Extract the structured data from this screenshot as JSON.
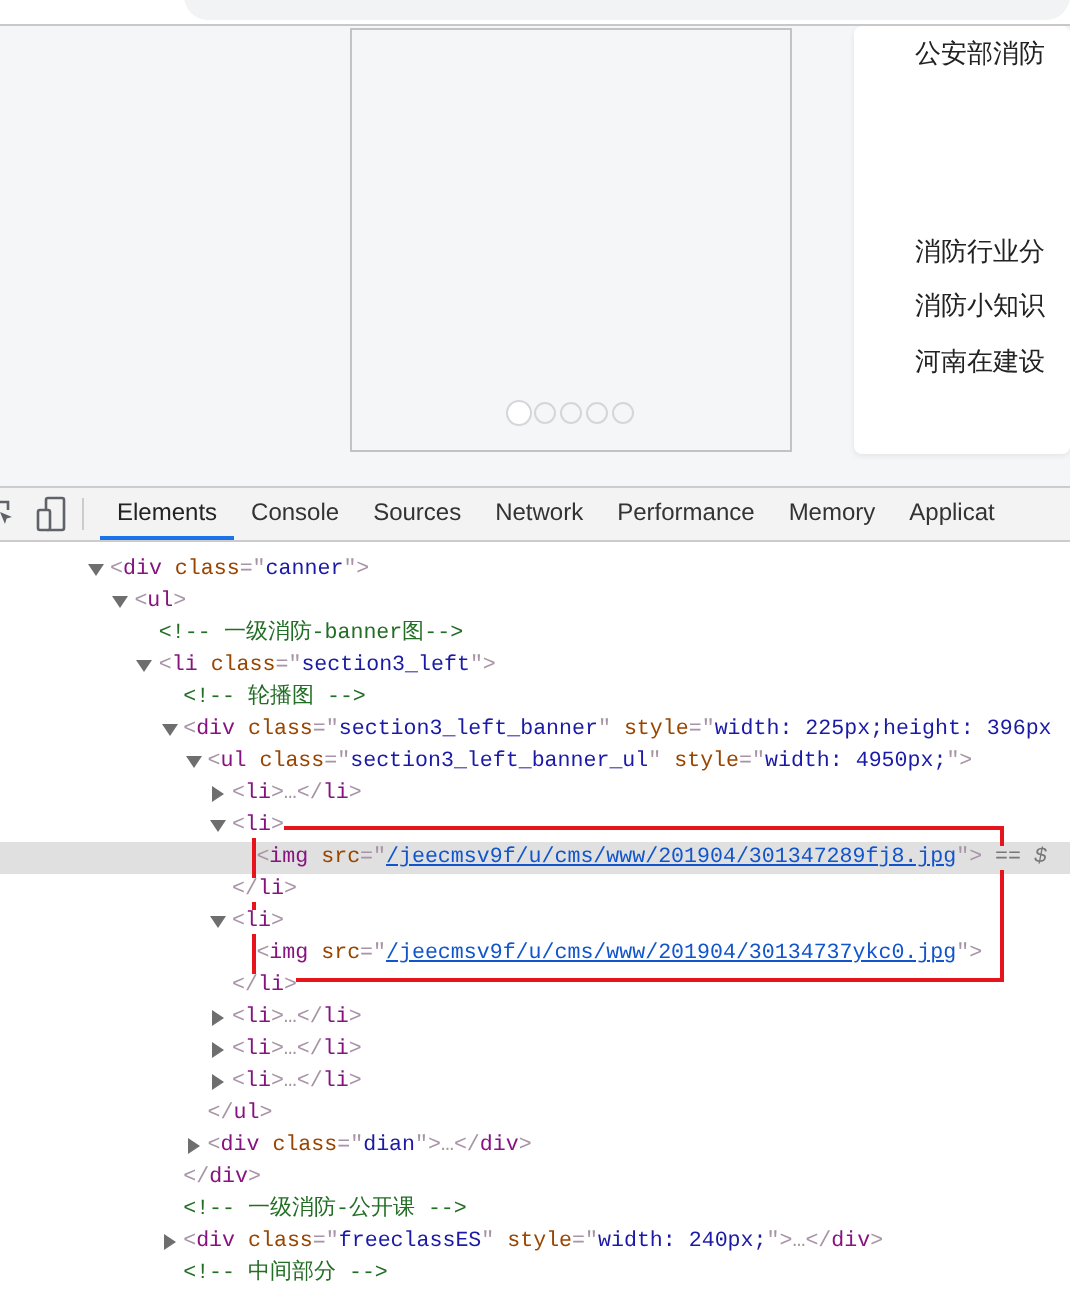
{
  "page": {
    "carousel": {
      "dots": [
        {
          "selected": true
        },
        {
          "selected": false
        },
        {
          "selected": false
        },
        {
          "selected": false
        },
        {
          "selected": false
        }
      ]
    },
    "news": [
      {
        "text": "公安部消防"
      },
      {
        "text": "消防行业分"
      },
      {
        "text": "消防小知识"
      },
      {
        "text": "河南在建设"
      }
    ]
  },
  "devtools": {
    "tabs": [
      {
        "label": "Elements",
        "selected": true
      },
      {
        "label": "Console",
        "selected": false
      },
      {
        "label": "Sources",
        "selected": false
      },
      {
        "label": "Network",
        "selected": false
      },
      {
        "label": "Performance",
        "selected": false
      },
      {
        "label": "Memory",
        "selected": false
      },
      {
        "label": "Applicat",
        "selected": false
      }
    ],
    "tree": [
      {
        "expanded": true,
        "selected": false,
        "tokens": [
          {
            "kind": "punct",
            "text": "<"
          },
          {
            "kind": "tag",
            "text": "div"
          },
          {
            "kind": "attr",
            "text": " class"
          },
          {
            "kind": "punct",
            "text": "=\""
          },
          {
            "kind": "value",
            "text": "canner"
          },
          {
            "kind": "punct",
            "text": "\">"
          }
        ],
        "children": [
          {
            "expanded": true,
            "selected": false,
            "tokens": [
              {
                "kind": "punct",
                "text": "<"
              },
              {
                "kind": "tag",
                "text": "ul"
              },
              {
                "kind": "punct",
                "text": ">"
              }
            ],
            "children": [
              {
                "selected": false,
                "tokens": [
                  {
                    "kind": "comment",
                    "text": "<!-- 一级消防-banner图-->"
                  }
                ]
              },
              {
                "expanded": true,
                "selected": false,
                "tokens": [
                  {
                    "kind": "punct",
                    "text": "<"
                  },
                  {
                    "kind": "tag",
                    "text": "li"
                  },
                  {
                    "kind": "attr",
                    "text": " class"
                  },
                  {
                    "kind": "punct",
                    "text": "=\""
                  },
                  {
                    "kind": "value",
                    "text": "section3_left"
                  },
                  {
                    "kind": "punct",
                    "text": "\">"
                  }
                ],
                "children": [
                  {
                    "selected": false,
                    "tokens": [
                      {
                        "kind": "comment",
                        "text": "<!-- 轮播图 -->"
                      }
                    ]
                  },
                  {
                    "expanded": true,
                    "selected": false,
                    "tokens": [
                      {
                        "kind": "punct",
                        "text": "<"
                      },
                      {
                        "kind": "tag",
                        "text": "div"
                      },
                      {
                        "kind": "attr",
                        "text": " class"
                      },
                      {
                        "kind": "punct",
                        "text": "=\""
                      },
                      {
                        "kind": "value",
                        "text": "section3_left_banner"
                      },
                      {
                        "kind": "punct",
                        "text": "\""
                      },
                      {
                        "kind": "attr",
                        "text": " style"
                      },
                      {
                        "kind": "punct",
                        "text": "=\""
                      },
                      {
                        "kind": "value",
                        "text": "width: 225px;height: 396px"
                      }
                    ],
                    "children": [
                      {
                        "expanded": true,
                        "selected": false,
                        "tokens": [
                          {
                            "kind": "punct",
                            "text": "<"
                          },
                          {
                            "kind": "tag",
                            "text": "ul"
                          },
                          {
                            "kind": "attr",
                            "text": " class"
                          },
                          {
                            "kind": "punct",
                            "text": "=\""
                          },
                          {
                            "kind": "value",
                            "text": "section3_left_banner_ul"
                          },
                          {
                            "kind": "punct",
                            "text": "\""
                          },
                          {
                            "kind": "attr",
                            "text": " style"
                          },
                          {
                            "kind": "punct",
                            "text": "=\""
                          },
                          {
                            "kind": "value",
                            "text": "width: 4950px;"
                          },
                          {
                            "kind": "punct",
                            "text": "\">"
                          }
                        ],
                        "children": [
                          {
                            "expanded": false,
                            "selected": false,
                            "tokens": [
                              {
                                "kind": "punct",
                                "text": "<"
                              },
                              {
                                "kind": "tag",
                                "text": "li"
                              },
                              {
                                "kind": "punct",
                                "text": ">…</"
                              },
                              {
                                "kind": "tag",
                                "text": "li"
                              },
                              {
                                "kind": "punct",
                                "text": ">"
                              }
                            ]
                          },
                          {
                            "expanded": true,
                            "selected": false,
                            "tokens": [
                              {
                                "kind": "punct",
                                "text": "<"
                              },
                              {
                                "kind": "tag",
                                "text": "li"
                              },
                              {
                                "kind": "punct",
                                "text": ">"
                              }
                            ],
                            "children": [
                              {
                                "selected": true,
                                "tokens": [
                                  {
                                    "kind": "punct",
                                    "text": "<"
                                  },
                                  {
                                    "kind": "tag",
                                    "text": "img"
                                  },
                                  {
                                    "kind": "attr",
                                    "text": " src"
                                  },
                                  {
                                    "kind": "punct",
                                    "text": "=\""
                                  },
                                  {
                                    "kind": "link",
                                    "text": "/jeecmsv9f/u/cms/www/201904/301347289fj8.jpg"
                                  },
                                  {
                                    "kind": "punct",
                                    "text": "\">"
                                  },
                                  {
                                    "kind": "marker",
                                    "text": " == $"
                                  }
                                ]
                              }
                            ],
                            "close": [
                              {
                                "kind": "punct",
                                "text": "</"
                              },
                              {
                                "kind": "tag",
                                "text": "li"
                              },
                              {
                                "kind": "punct",
                                "text": ">"
                              }
                            ]
                          },
                          {
                            "expanded": true,
                            "selected": false,
                            "tokens": [
                              {
                                "kind": "punct",
                                "text": "<"
                              },
                              {
                                "kind": "tag",
                                "text": "li"
                              },
                              {
                                "kind": "punct",
                                "text": ">"
                              }
                            ],
                            "children": [
                              {
                                "selected": false,
                                "tokens": [
                                  {
                                    "kind": "punct",
                                    "text": "<"
                                  },
                                  {
                                    "kind": "tag",
                                    "text": "img"
                                  },
                                  {
                                    "kind": "attr",
                                    "text": " src"
                                  },
                                  {
                                    "kind": "punct",
                                    "text": "=\""
                                  },
                                  {
                                    "kind": "link",
                                    "text": "/jeecmsv9f/u/cms/www/201904/30134737ykc0.jpg"
                                  },
                                  {
                                    "kind": "punct",
                                    "text": "\">"
                                  }
                                ]
                              }
                            ],
                            "close": [
                              {
                                "kind": "punct",
                                "text": "</"
                              },
                              {
                                "kind": "tag",
                                "text": "li"
                              },
                              {
                                "kind": "punct",
                                "text": ">"
                              }
                            ]
                          },
                          {
                            "expanded": false,
                            "selected": false,
                            "tokens": [
                              {
                                "kind": "punct",
                                "text": "<"
                              },
                              {
                                "kind": "tag",
                                "text": "li"
                              },
                              {
                                "kind": "punct",
                                "text": ">…</"
                              },
                              {
                                "kind": "tag",
                                "text": "li"
                              },
                              {
                                "kind": "punct",
                                "text": ">"
                              }
                            ]
                          },
                          {
                            "expanded": false,
                            "selected": false,
                            "tokens": [
                              {
                                "kind": "punct",
                                "text": "<"
                              },
                              {
                                "kind": "tag",
                                "text": "li"
                              },
                              {
                                "kind": "punct",
                                "text": ">…</"
                              },
                              {
                                "kind": "tag",
                                "text": "li"
                              },
                              {
                                "kind": "punct",
                                "text": ">"
                              }
                            ]
                          },
                          {
                            "expanded": false,
                            "selected": false,
                            "tokens": [
                              {
                                "kind": "punct",
                                "text": "<"
                              },
                              {
                                "kind": "tag",
                                "text": "li"
                              },
                              {
                                "kind": "punct",
                                "text": ">…</"
                              },
                              {
                                "kind": "tag",
                                "text": "li"
                              },
                              {
                                "kind": "punct",
                                "text": ">"
                              }
                            ]
                          }
                        ],
                        "close": [
                          {
                            "kind": "punct",
                            "text": "</"
                          },
                          {
                            "kind": "tag",
                            "text": "ul"
                          },
                          {
                            "kind": "punct",
                            "text": ">"
                          }
                        ]
                      },
                      {
                        "expanded": false,
                        "selected": false,
                        "tokens": [
                          {
                            "kind": "punct",
                            "text": "<"
                          },
                          {
                            "kind": "tag",
                            "text": "div"
                          },
                          {
                            "kind": "attr",
                            "text": " class"
                          },
                          {
                            "kind": "punct",
                            "text": "=\""
                          },
                          {
                            "kind": "value",
                            "text": "dian"
                          },
                          {
                            "kind": "punct",
                            "text": "\">…</"
                          },
                          {
                            "kind": "tag",
                            "text": "div"
                          },
                          {
                            "kind": "punct",
                            "text": ">"
                          }
                        ]
                      }
                    ],
                    "close": [
                      {
                        "kind": "punct",
                        "text": "</"
                      },
                      {
                        "kind": "tag",
                        "text": "div"
                      },
                      {
                        "kind": "punct",
                        "text": ">"
                      }
                    ]
                  },
                  {
                    "selected": false,
                    "tokens": [
                      {
                        "kind": "comment",
                        "text": "<!-- 一级消防-公开课 -->"
                      }
                    ]
                  },
                  {
                    "expanded": false,
                    "selected": false,
                    "tokens": [
                      {
                        "kind": "punct",
                        "text": "<"
                      },
                      {
                        "kind": "tag",
                        "text": "div"
                      },
                      {
                        "kind": "attr",
                        "text": " class"
                      },
                      {
                        "kind": "punct",
                        "text": "=\""
                      },
                      {
                        "kind": "value",
                        "text": "freeclassES"
                      },
                      {
                        "kind": "punct",
                        "text": "\""
                      },
                      {
                        "kind": "attr",
                        "text": " style"
                      },
                      {
                        "kind": "punct",
                        "text": "=\""
                      },
                      {
                        "kind": "value",
                        "text": "width: 240px;"
                      },
                      {
                        "kind": "punct",
                        "text": "\">…</"
                      },
                      {
                        "kind": "tag",
                        "text": "div"
                      },
                      {
                        "kind": "punct",
                        "text": ">"
                      }
                    ]
                  },
                  {
                    "selected": false,
                    "tokens": [
                      {
                        "kind": "comment",
                        "text": "<!-- 中间部分 -->"
                      }
                    ]
                  }
                ]
              }
            ]
          }
        ]
      }
    ]
  }
}
